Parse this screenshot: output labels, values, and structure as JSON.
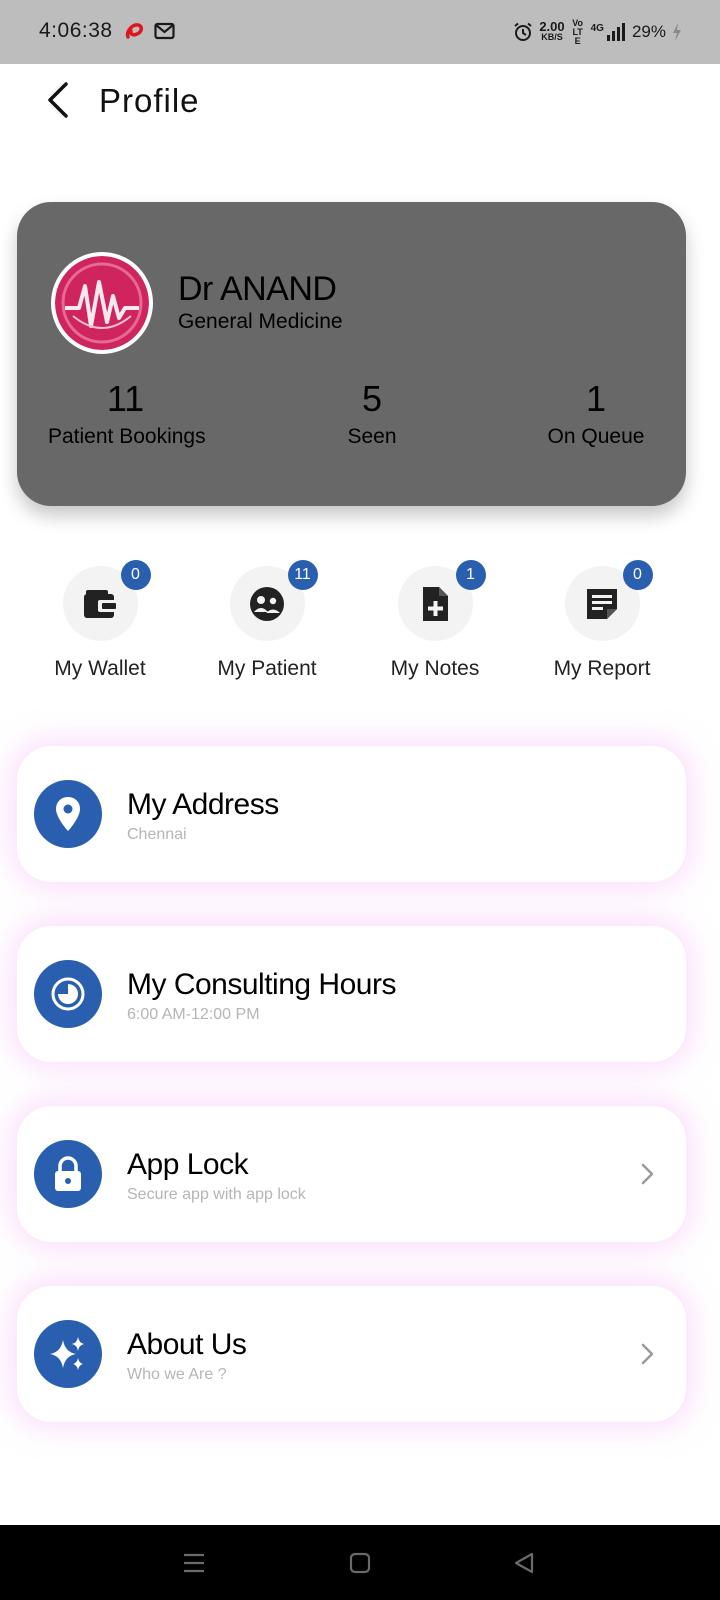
{
  "status_bar": {
    "time": "4:06:38",
    "speed_value": "2.00",
    "speed_unit": "KB/S",
    "volte": "Vo LTE",
    "network": "4G",
    "battery": "29%",
    "icons": [
      "airtel-icon",
      "gmail-icon",
      "alarm-icon",
      "signal-icon",
      "battery-charging-icon"
    ]
  },
  "header": {
    "title": "Profile",
    "back_icon": "back-arrow-icon"
  },
  "profile": {
    "name": "Dr ANAND",
    "specialty": "General Medicine",
    "stats": [
      {
        "value": "11",
        "label": "Patient Bookings"
      },
      {
        "value": "5",
        "label": "Seen"
      },
      {
        "value": "1",
        "label": "On Queue"
      }
    ]
  },
  "quick_actions": [
    {
      "label": "My Wallet",
      "badge": "0",
      "icon": "wallet-icon"
    },
    {
      "label": "My Patient",
      "badge": "11",
      "icon": "patient-group-icon"
    },
    {
      "label": "My Notes",
      "badge": "1",
      "icon": "note-add-icon"
    },
    {
      "label": "My Report",
      "badge": "0",
      "icon": "report-icon"
    }
  ],
  "menu": [
    {
      "title": "My Address",
      "subtitle": "Chennai",
      "icon": "location-pin-icon",
      "chevron": false
    },
    {
      "title": "My Consulting Hours",
      "subtitle": "6:00 AM-12:00 PM",
      "icon": "clock-icon",
      "chevron": false
    },
    {
      "title": "App Lock",
      "subtitle": "Secure app with app lock",
      "icon": "lock-icon",
      "chevron": true
    },
    {
      "title": "About Us",
      "subtitle": "Who we Are ?",
      "icon": "sparkle-icon",
      "chevron": true
    }
  ],
  "colors": {
    "accent": "#2a5fb0",
    "card_grey": "#686868",
    "status_bar": "#bdbdbd",
    "subtitle_grey": "#b5b5b5",
    "glow_pink": "#f8c8f8"
  }
}
